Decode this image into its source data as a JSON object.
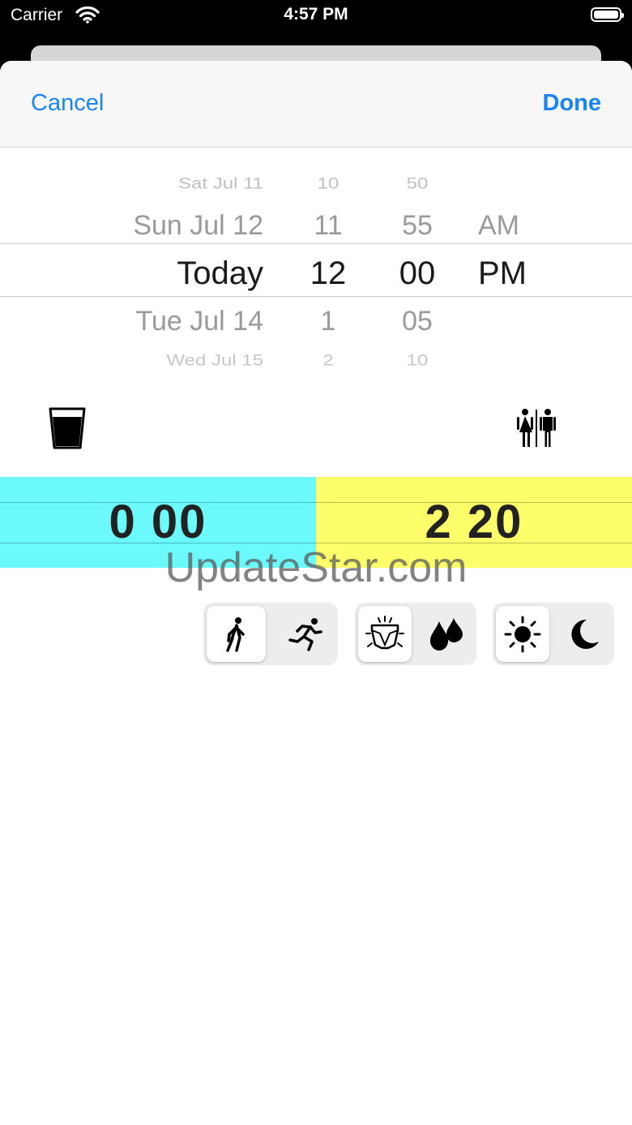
{
  "status_bar": {
    "carrier": "Carrier",
    "time": "4:57 PM"
  },
  "nav": {
    "cancel_label": "Cancel",
    "done_label": "Done"
  },
  "date_picker": {
    "dates": [
      "Sat Jul 11",
      "Sun Jul 12",
      "Today",
      "Tue Jul 14",
      "Wed Jul 15"
    ],
    "hours": [
      "10",
      "11",
      "12",
      "1",
      "2"
    ],
    "minutes": [
      "50",
      "55",
      "00",
      "05",
      "10"
    ],
    "ampm": [
      "",
      "AM",
      "PM",
      "",
      ""
    ],
    "selected": {
      "date": "Today",
      "hour": "12",
      "minute": "00",
      "ampm": "PM"
    }
  },
  "counters": {
    "intake": {
      "icon": "drinking-glass-icon",
      "value": "0  00",
      "color": "#6bf9fb"
    },
    "output": {
      "icon": "restroom-icon",
      "value": "2  20",
      "color": "#fefe6a"
    }
  },
  "watermark": "UpdateStar.com",
  "segments": [
    {
      "name": "activity",
      "options": [
        "walking-icon",
        "running-icon"
      ],
      "selected": 0
    },
    {
      "name": "output-type",
      "options": [
        "diaper-icon",
        "drops-icon"
      ],
      "selected": 0
    },
    {
      "name": "time-of-day",
      "options": [
        "sun-icon",
        "moon-icon"
      ],
      "selected": 0
    }
  ],
  "colors": {
    "accent": "#1a84f0",
    "intake_bg": "#6bf9fb",
    "output_bg": "#fefe6a"
  }
}
